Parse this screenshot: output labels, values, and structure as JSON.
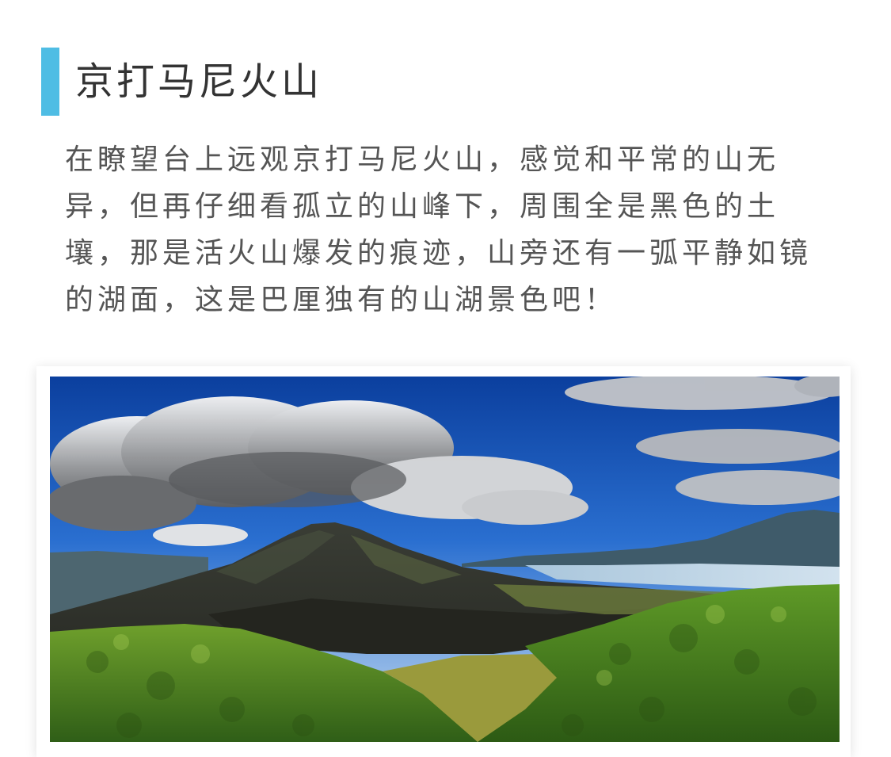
{
  "section": {
    "title": "京打马尼火山",
    "accent_color": "#4fbde4",
    "paragraph": "在瞭望台上远观京打马尼火山，感觉和平常的山无异，但再仔细看孤立的山峰下，周围全是黑色的土壤，那是活火山爆发的痕迹，山旁还有一弧平静如镜的湖面，这是巴厘独有的山湖景色吧！"
  },
  "photo": {
    "subject": "volcano-landscape"
  }
}
